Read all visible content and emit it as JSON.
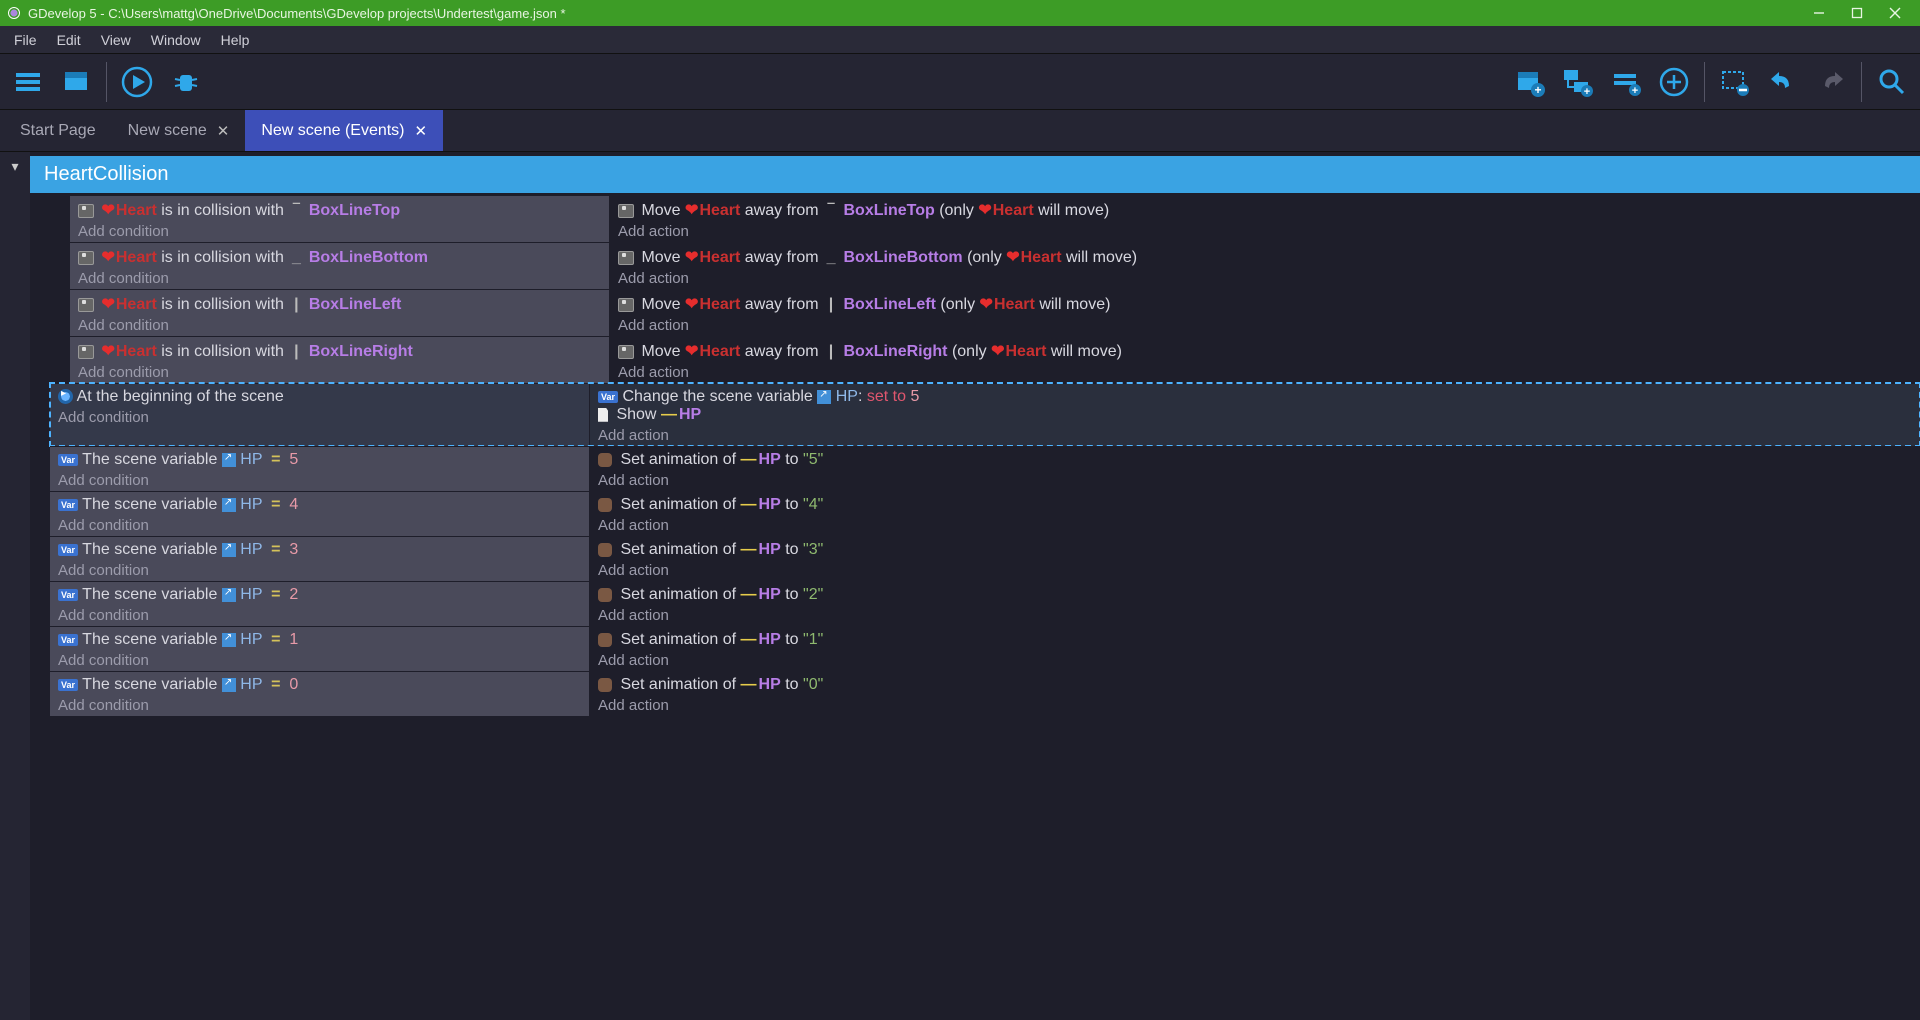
{
  "window": {
    "title": "GDevelop 5 - C:\\Users\\mattg\\OneDrive\\Documents\\GDevelop projects\\Undertest\\game.json *"
  },
  "menu": [
    "File",
    "Edit",
    "View",
    "Window",
    "Help"
  ],
  "tabs": [
    {
      "label": "Start Page",
      "closable": false
    },
    {
      "label": "New scene",
      "closable": true
    },
    {
      "label": "New scene (Events)",
      "closable": true
    }
  ],
  "active_tab": 2,
  "group_name": "HeartCollision",
  "strings": {
    "add_condition": "Add condition",
    "add_action": "Add action",
    "collision_verb": "is in collision with",
    "move_verb": "Move",
    "away_from": "away from",
    "only_prefix": "(only",
    "will_move": "will move)",
    "scene_begin": "At the beginning of the scene",
    "change_scene_var": "Change the scene variable",
    "hp_var": "HP",
    "set_to": "set to",
    "show": "Show",
    "scene_var_is": "The scene variable",
    "set_anim_of": "Set animation of",
    "to": "to"
  },
  "heart": "Heart",
  "hp_obj": "HP",
  "collision_lines": [
    {
      "shape": "‾",
      "name": "BoxLineTop"
    },
    {
      "shape": "_",
      "name": "BoxLineBottom"
    },
    {
      "shape": "|",
      "name": "BoxLineLeft"
    },
    {
      "shape": "|",
      "name": "BoxLineRight"
    }
  ],
  "begin_hp": "5",
  "hp_checks": [
    {
      "val": "5",
      "anim": "\"5\""
    },
    {
      "val": "4",
      "anim": "\"4\""
    },
    {
      "val": "3",
      "anim": "\"3\""
    },
    {
      "val": "2",
      "anim": "\"2\""
    },
    {
      "val": "1",
      "anim": "\"1\""
    },
    {
      "val": "0",
      "anim": "\"0\""
    }
  ]
}
